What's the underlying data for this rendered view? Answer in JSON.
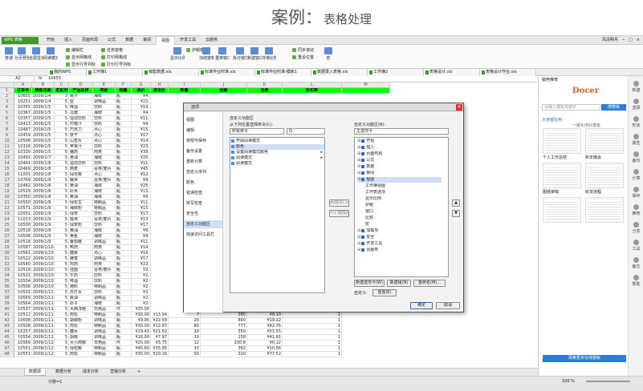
{
  "title": {
    "main": "案例",
    "sep": "：",
    "sub": "表格处理"
  },
  "app": {
    "name": "WPS 表格",
    "menus": [
      "开始",
      "插入",
      "页面布局",
      "公式",
      "数据",
      "审阅",
      "视图",
      "开发工具",
      "云服务"
    ],
    "active_menu": "视图",
    "user": "风清明月"
  },
  "ribbon": [
    {
      "label": "普通",
      "icon": "normal-view-icon"
    },
    {
      "label": "分页预览",
      "icon": "page-break-icon"
    },
    {
      "label": "全屏显示",
      "icon": "fullscreen-icon"
    },
    {
      "label": "阅读模式",
      "icon": "reading-icon"
    },
    {
      "label": "编辑栏",
      "icon": "checkbox-icon"
    },
    {
      "label": "显示网格线",
      "icon": "checkbox-icon"
    },
    {
      "label": "显示行号列标",
      "icon": "checkbox-icon"
    },
    {
      "label": "任务窗格",
      "icon": "checkbox-icon"
    },
    {
      "label": "打印网格线",
      "icon": "checkbox-icon"
    },
    {
      "label": "打印行号列标",
      "icon": "checkbox-icon"
    },
    {
      "label": "显示比例",
      "icon": "zoom-icon"
    },
    {
      "label": "护眼模式",
      "icon": "eye-icon"
    },
    {
      "label": "冻结窗格",
      "icon": "freeze-icon"
    },
    {
      "label": "重排窗口",
      "icon": "arrange-icon"
    },
    {
      "label": "拆分窗口",
      "icon": "split-icon"
    },
    {
      "label": "新建窗口",
      "icon": "new-window-icon"
    },
    {
      "label": "并排比较",
      "icon": "compare-icon"
    },
    {
      "label": "同步滚动",
      "icon": "sync-icon"
    },
    {
      "label": "重设位置",
      "icon": "reset-icon"
    },
    {
      "label": "宏",
      "icon": "macro-icon"
    }
  ],
  "doc_tabs": [
    "我的WPS",
    "工作簿1",
    "销售数据.xls",
    "标准作业时准.xls",
    "标准作业时准-模板1",
    "数据录入表格.xls",
    "工作簿2",
    "表格设计.xls",
    "表格设计作业.xls"
  ],
  "formula": {
    "cell": "A2",
    "value": "10655"
  },
  "columns": [
    "A",
    "B",
    "C",
    "D",
    "E",
    "F",
    "G",
    "H",
    "I",
    "J",
    "K",
    "L",
    "M"
  ],
  "headers": [
    "订单号",
    "销售日期",
    "发货天数",
    "产品名称",
    "类别",
    "销量",
    "单价",
    "成本价",
    "数量",
    "金额",
    "运费",
    "折扣率",
    ""
  ],
  "rows": [
    [
      "10655",
      "2009/1/4",
      "3",
      "纸子",
      "海鲜",
      "瓶",
      "¥4."
    ],
    [
      "10251",
      "2009/1/4",
      "5",
      "蓝",
      "调味品",
      "瓶",
      "¥22."
    ],
    [
      "10355",
      "2009/1/5",
      "5",
      "啤酒",
      "饮料",
      "瓶",
      "¥19."
    ],
    [
      "10367",
      "2009/1/5",
      "5",
      "瓜酱",
      "海鲜",
      "瓶",
      "¥4."
    ],
    [
      "10357",
      "2009/1/5",
      "5",
      "运动饮料",
      "饮料",
      "瓶",
      "¥11."
    ],
    [
      "10413",
      "2009/1/5",
      "5",
      "柠檬汁",
      "饮料",
      "瓶",
      "¥4."
    ],
    [
      "10487",
      "2009/1/5",
      "5",
      "巧克力",
      "点心",
      "瓶",
      "¥15."
    ],
    [
      "10459",
      "2009/1/5",
      "5",
      "饼干",
      "点心",
      "瓶",
      "¥17."
    ],
    [
      "10508",
      "2009/1/5",
      "5",
      "山查片",
      "点心",
      "瓶",
      "¥14."
    ],
    [
      "10316",
      "2009/1/5",
      "5",
      "苹果汁",
      "饮料",
      "瓶",
      "¥23."
    ],
    [
      "10330",
      "2009/1/5",
      "5",
      "猪肉",
      "肉类",
      "瓶",
      "¥39."
    ],
    [
      "10491",
      "2009/1/7",
      "5",
      "黄油",
      "海鲜",
      "瓶",
      "¥20."
    ],
    [
      "10461",
      "2009/1/8",
      "5",
      "运动饮料",
      "饮料",
      "瓶",
      "¥11."
    ],
    [
      "10469",
      "2009/1/8",
      "5",
      "燕麦",
      "谷类/麦片",
      "瓶",
      "¥45."
    ],
    [
      "11001",
      "2009/1/8",
      "5",
      "绿花椰",
      "点心",
      "瓶",
      "¥12."
    ],
    [
      "10769",
      "2009/1/8",
      "5",
      "糯米",
      "谷类/麦片",
      "瓶",
      "¥9."
    ],
    [
      "10482",
      "2009/1/8",
      "5",
      "黄油",
      "海鲜",
      "瓶",
      "¥25."
    ],
    [
      "10529",
      "2009/1/8",
      "5",
      "虾米",
      "海鲜",
      "瓶",
      "¥13."
    ],
    [
      "10350",
      "2009/1/8",
      "5",
      "黄油",
      "海鲜",
      "瓶",
      "¥9."
    ],
    [
      "10550",
      "2009/1/8",
      "5",
      "绿花生",
      "特制品",
      "瓶",
      "¥11."
    ],
    [
      "10571",
      "2009/1/9",
      "5",
      "海鲜粉",
      "特制品",
      "瓶",
      "¥15."
    ],
    [
      "10551",
      "2009/1/9",
      "5",
      "绿茶",
      "饮料",
      "瓶",
      "¥17."
    ],
    [
      "11013",
      "2009/1/9",
      "5",
      "糙米",
      "谷类/麦片",
      "瓶",
      "¥13."
    ],
    [
      "10500",
      "2009/1/9",
      "5",
      "绿茶粉",
      "饮料",
      "瓶",
      "¥17."
    ],
    [
      "10518",
      "2009/1/9",
      "5",
      "黄油",
      "海鲜",
      "瓶",
      "¥9."
    ],
    [
      "10506",
      "2009/1/9",
      "5",
      "黄鱼",
      "海鲜",
      "瓶",
      "¥9."
    ],
    [
      "10518",
      "2009/1/9",
      "5",
      "番茄酱",
      "调味品",
      "瓶",
      "¥11."
    ],
    [
      "10587",
      "2009/1/10",
      "5",
      "鸭肉",
      "肉类",
      "瓶",
      "¥14."
    ],
    [
      "10561",
      "2009/1/10",
      "5",
      "糖果",
      "点心",
      "瓶",
      "¥16."
    ],
    [
      "10522",
      "2009/1/10",
      "5",
      "蜂蜜",
      "调味品",
      "瓶",
      "¥17."
    ],
    [
      "10540",
      "2009/1/10",
      "5",
      "鸡肉",
      "肉类",
      "瓶",
      "¥22."
    ],
    [
      "10519",
      "2009/1/10",
      "5",
      "挂面",
      "谷类/麦片",
      "瓶",
      "¥2."
    ],
    [
      "10521",
      "2009/1/10",
      "5",
      "牛奶",
      "饮料",
      "瓶",
      "¥1."
    ],
    [
      "10534",
      "2009/1/10",
      "5",
      "啤酒",
      "饮料",
      "瓶",
      "¥2."
    ],
    [
      "10506",
      "2009/1/10",
      "5",
      "烤料",
      "特制品",
      "瓶",
      "¥2."
    ],
    [
      "10531",
      "2009/1/11",
      "5",
      "苏打水",
      "饮料",
      "瓶",
      "¥2."
    ],
    [
      "10569",
      "2009/1/11",
      "5",
      "蚝油",
      "调味品",
      "瓶",
      "¥2."
    ],
    [
      "10564",
      "2009/1/11",
      "5",
      "虾子",
      "海鲜",
      "瓶",
      "¥2."
    ],
    [
      "10537",
      "2009/1/11",
      "5",
      "大西洋鲑",
      "日用品",
      "件",
      "¥35.00"
    ],
    [
      "10512",
      "2009/1/11",
      "5",
      "肉松",
      "特制品",
      "瓶",
      "¥30.00"
    ],
    [
      "10608",
      "2009/1/11",
      "5",
      "胡椒粉",
      "调味品",
      "瓶",
      "¥9.95"
    ],
    [
      "10508",
      "2009/1/11",
      "5",
      "肉松",
      "特制品",
      "瓶",
      "¥30.00"
    ],
    [
      "10257",
      "2009/1/11",
      "5",
      "糖水",
      "调味品",
      "瓶",
      "¥19.40"
    ],
    [
      "10554",
      "2009/1/12",
      "5",
      "胡桃",
      "调味品",
      "瓶",
      "¥16.00"
    ],
    [
      "10569",
      "2009/1/12",
      "5",
      "大小肉粽",
      "日用品",
      "件",
      "¥20.00"
    ],
    [
      "10551",
      "2009/1/12",
      "5",
      "绿花椰",
      "特制品",
      "瓶",
      "¥45.60"
    ],
    [
      "10551",
      "2009/1/12",
      "5",
      "肉松",
      "特制品",
      "瓶",
      "¥30.00"
    ]
  ],
  "extra_rows": [
    [
      "¥13.94",
      "7",
      "385",
      "¥8.10",
      "1"
    ],
    [
      "¥22.58",
      "20",
      "800",
      "¥19.22",
      "1"
    ],
    [
      "¥12.97",
      "80",
      "777",
      "¥82.76",
      "1"
    ],
    [
      "¥21.02",
      "10",
      "350",
      "¥53.55",
      "1"
    ],
    [
      "¥7.97",
      "10",
      "158",
      "¥41.91",
      "1"
    ],
    [
      "¥5.75",
      "12",
      "200.8",
      "¥0.12",
      "1"
    ],
    [
      "¥35.95",
      "10",
      "362",
      "¥10.56",
      "1"
    ],
    [
      "¥20.16",
      "50",
      "310",
      "¥77.52",
      "1"
    ]
  ],
  "sheet_tabs": [
    "数据源",
    "数据分析",
    "成本分析",
    "营销分析"
  ],
  "status": {
    "left": "计数=1",
    "zoom": "100 %"
  },
  "sidebar": {
    "title": "稿壳推荐",
    "brand": "Docer",
    "search_placeholder": "请输入模板关键字",
    "search_btn": "搜模板",
    "section": "大家都在用",
    "section_sub": "一键实用好模板",
    "captions": [
      "个人工作总结",
      "新年晚会",
      "图纸审稿",
      "收货流程"
    ],
    "tools": [
      "新建",
      "选择",
      "形状",
      "属性",
      "备份",
      "计算",
      "保存",
      "推荐",
      "分享",
      "工具",
      "备忘",
      "帮助"
    ],
    "bottom_btn": "探索更多在线模板"
  },
  "dialog": {
    "title": "选项",
    "close": "×",
    "nav": [
      "视图",
      "编辑",
      "常规与保存",
      "备份设置",
      "重新计算",
      "自定义序列",
      "颜色",
      "错误检查",
      "拼写检查",
      "安全性",
      "自定义功能区",
      "快速访问工具栏"
    ],
    "active_nav": "自定义功能区",
    "section_title": "自定义功能区",
    "from_label": "从下列位置选择命令(C):",
    "from_value": "所有命令",
    "left_items": [
      "开启阅读模式",
      "颜色",
      "设置阅读模式颜色",
      "阅读模式",
      "阅读模式"
    ],
    "right_label": "自定义功能区(B):",
    "right_value": "主选项卡",
    "right_items": [
      "开始",
      "插入",
      "页面布局",
      "公式",
      "数据",
      "审阅",
      "视图",
      "工作簿视图",
      "工作表选项",
      "显示比例",
      "护眼",
      "窗口",
      "比较",
      "宏",
      "加载项",
      "安全",
      "开发工具",
      "云服务"
    ],
    "add_btn": "添加(A) >>",
    "remove_btn": "<< 删除(R)",
    "new_tab_btn": "新建选项卡(W)",
    "new_group_btn": "新建组(N)",
    "rename_btn": "重命名(M)...",
    "custom_label": "自定义:",
    "reset_btn": "重置(E)",
    "ok_btn": "确定",
    "cancel_btn": "取消"
  }
}
